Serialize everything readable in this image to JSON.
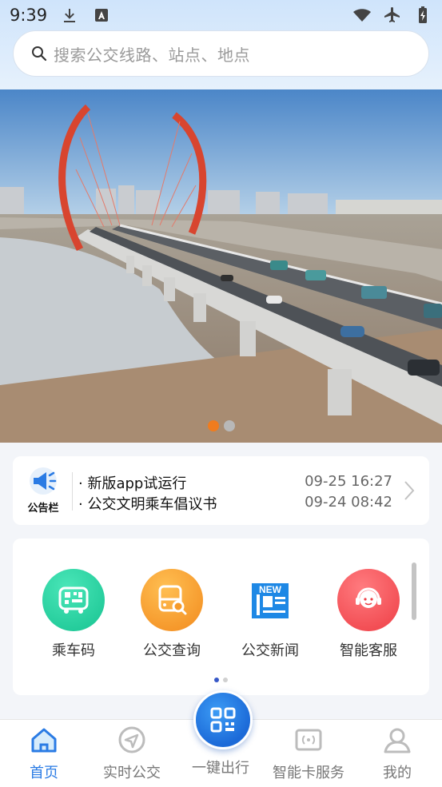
{
  "status": {
    "time": "9:39"
  },
  "search": {
    "placeholder": "搜索公交线路、站点、地点"
  },
  "notice": {
    "logo_label": "公告栏",
    "items": [
      {
        "title": "· 新版app试运行",
        "date": "09-25 16:27"
      },
      {
        "title": "· 公交文明乘车倡议书",
        "date": "09-24 08:42"
      }
    ]
  },
  "services": [
    {
      "label": "乘车码",
      "icon": "bus-qr-icon",
      "color": "#1fcf9e"
    },
    {
      "label": "公交查询",
      "icon": "bus-search-icon",
      "color": "#f59a2a"
    },
    {
      "label": "公交新闻",
      "icon": "news-icon",
      "color": "#2196f3"
    },
    {
      "label": "智能客服",
      "icon": "customer-service-icon",
      "color": "#f24b52"
    }
  ],
  "nav": {
    "items": [
      {
        "label": "首页",
        "icon": "home-icon",
        "active": true
      },
      {
        "label": "实时公交",
        "icon": "realtime-bus-icon",
        "active": false
      },
      {
        "label": "一键出行",
        "icon": "qr-code-icon",
        "active": false
      },
      {
        "label": "智能卡服务",
        "icon": "nfc-card-icon",
        "active": false
      },
      {
        "label": "我的",
        "icon": "profile-icon",
        "active": false
      }
    ]
  },
  "colors": {
    "accent": "#2a7be4",
    "banner_dot_active": "#f07c1e"
  }
}
